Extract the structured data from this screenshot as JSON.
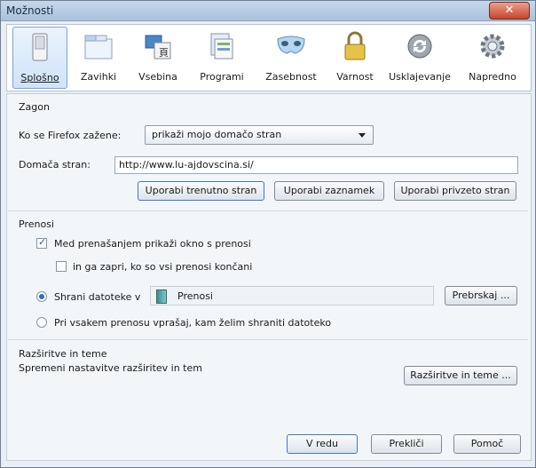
{
  "window": {
    "title": "Možnosti",
    "close_symbol": "✕"
  },
  "toolbar": {
    "items": [
      {
        "label": "Splošno",
        "icon": "switch-icon",
        "selected": true
      },
      {
        "label": "Zavihki",
        "icon": "tabs-icon",
        "selected": false
      },
      {
        "label": "Vsebina",
        "icon": "content-icon",
        "selected": false
      },
      {
        "label": "Programi",
        "icon": "applications-icon",
        "selected": false
      },
      {
        "label": "Zasebnost",
        "icon": "mask-icon",
        "selected": false
      },
      {
        "label": "Varnost",
        "icon": "lock-icon",
        "selected": false
      },
      {
        "label": "Usklajevanje",
        "icon": "sync-icon",
        "selected": false
      },
      {
        "label": "Napredno",
        "icon": "gear-icon",
        "selected": false
      }
    ]
  },
  "startup": {
    "heading": "Zagon",
    "when_label": "Ko se Firefox zažene:",
    "when_value": "prikaži mojo domačo stran",
    "home_label": "Domača stran:",
    "home_value": "http://www.lu-ajdovscina.si/",
    "btn_current": "Uporabi trenutno stran",
    "btn_bookmark": "Uporabi zaznamek",
    "btn_blank": "Uporabi privzeto stran"
  },
  "downloads": {
    "heading": "Prenosi",
    "show_window_label": "Med prenašanjem prikaži okno s prenosi",
    "show_window_checked": true,
    "close_when_done_label": "in ga zapri, ko so vsi prenosi končani",
    "close_when_done_checked": false,
    "save_to_label": "Shrani datoteke v",
    "save_to_folder": "Prenosi",
    "browse_button": "Prebrskaj ...",
    "ask_label": "Pri vsakem prenosu vprašaj, kam želim shraniti datoteko",
    "save_to_selected": true
  },
  "addons": {
    "heading": "Razširitve in teme",
    "description": "Spremeni nastavitve razširitev in tem",
    "button": "Razširitve in teme ..."
  },
  "footer": {
    "ok": "V redu",
    "cancel": "Prekliči",
    "help": "Pomoč"
  }
}
